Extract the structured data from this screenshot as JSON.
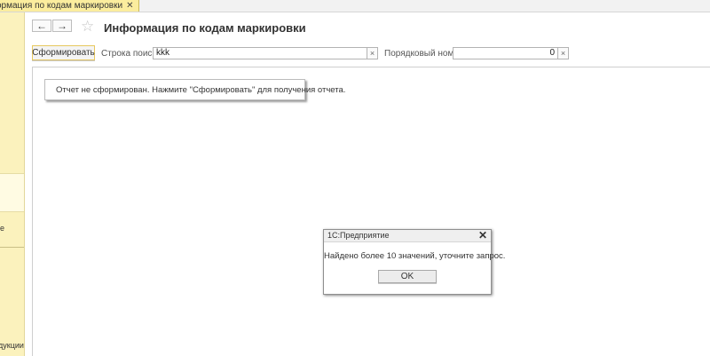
{
  "tab": {
    "title": "ормация по кодам маркировки",
    "close": "✕"
  },
  "left_panel": {
    "item_a": "е",
    "item_b": "дукции"
  },
  "nav": {
    "back": "←",
    "forward": "→",
    "favorite": "☆"
  },
  "form_title": "Информация по кодам маркировки",
  "toolbar": {
    "generate_label": "Сформировать",
    "search_label": "Строка поиска:",
    "search_value": "kkk",
    "serial_label": "Порядковый номер:",
    "serial_value": "0",
    "clear": "×"
  },
  "report_note": "Отчет не сформирован. Нажмите \"Сформировать\" для получения отчета.",
  "dialog": {
    "title": "1С:Предприятие",
    "close": "✕",
    "message": "Найдено более 10 значений, уточните запрос.",
    "ok_label": "OK"
  }
}
